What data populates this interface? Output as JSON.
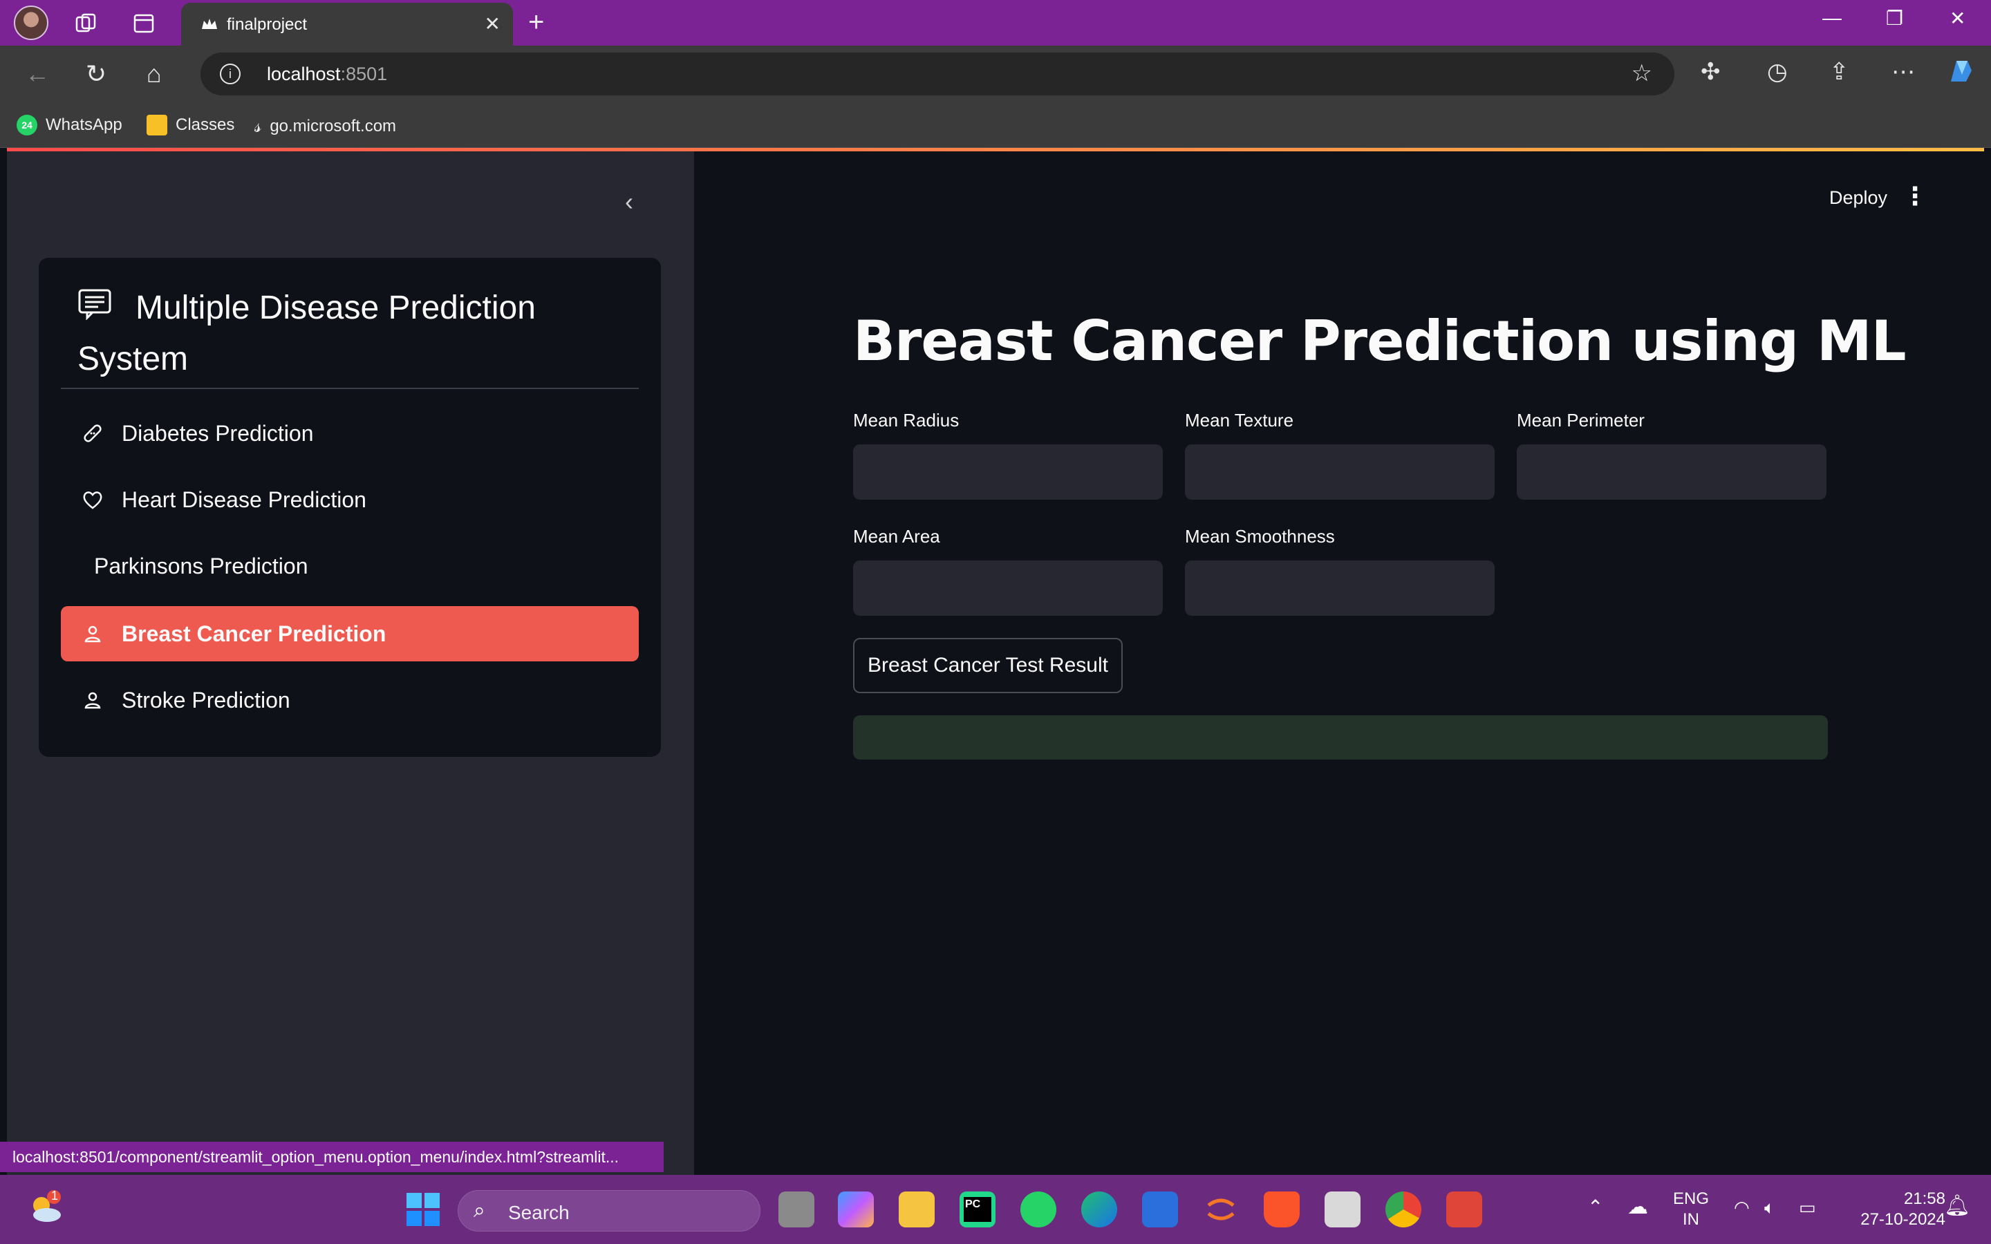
{
  "browser": {
    "tab_title": "finalproject",
    "url_host": "localhost",
    "url_port": ":8501",
    "bookmarks": [
      {
        "label": "WhatsApp",
        "badge": "24"
      },
      {
        "label": "Classes"
      },
      {
        "label": "go.microsoft.com"
      }
    ],
    "status_url": "localhost:8501/component/streamlit_option_menu.option_menu/index.html?streamlit..."
  },
  "sidebar": {
    "menu_title": "Multiple Disease Prediction System",
    "items": [
      {
        "label": "Diabetes Prediction",
        "icon": "bandaid-icon",
        "active": false
      },
      {
        "label": "Heart Disease Prediction",
        "icon": "heart-icon",
        "active": false
      },
      {
        "label": "Parkinsons Prediction",
        "icon": "",
        "active": false
      },
      {
        "label": "Breast Cancer Prediction",
        "icon": "person-icon",
        "active": true
      },
      {
        "label": "Stroke Prediction",
        "icon": "person-icon",
        "active": false
      }
    ]
  },
  "header": {
    "deploy_label": "Deploy"
  },
  "main": {
    "title": "Breast Cancer Prediction using ML",
    "fields": [
      {
        "label": "Mean Radius",
        "value": ""
      },
      {
        "label": "Mean Texture",
        "value": ""
      },
      {
        "label": "Mean Perimeter",
        "value": ""
      },
      {
        "label": "Mean Area",
        "value": ""
      },
      {
        "label": "Mean Smoothness",
        "value": ""
      }
    ],
    "button_label": "Breast Cancer Test Result",
    "result_text": ""
  },
  "taskbar": {
    "search_placeholder": "Search",
    "weather_badge": "1",
    "lang_line1": "ENG",
    "lang_line2": "IN",
    "time": "21:58",
    "date": "27-10-2024"
  },
  "colors": {
    "accent": "#ef5a50",
    "sidebar_bg": "#262730",
    "main_bg": "#0e1117",
    "input_bg": "#262730",
    "result_bg": "#233329",
    "titlebar": "#7b2295"
  }
}
